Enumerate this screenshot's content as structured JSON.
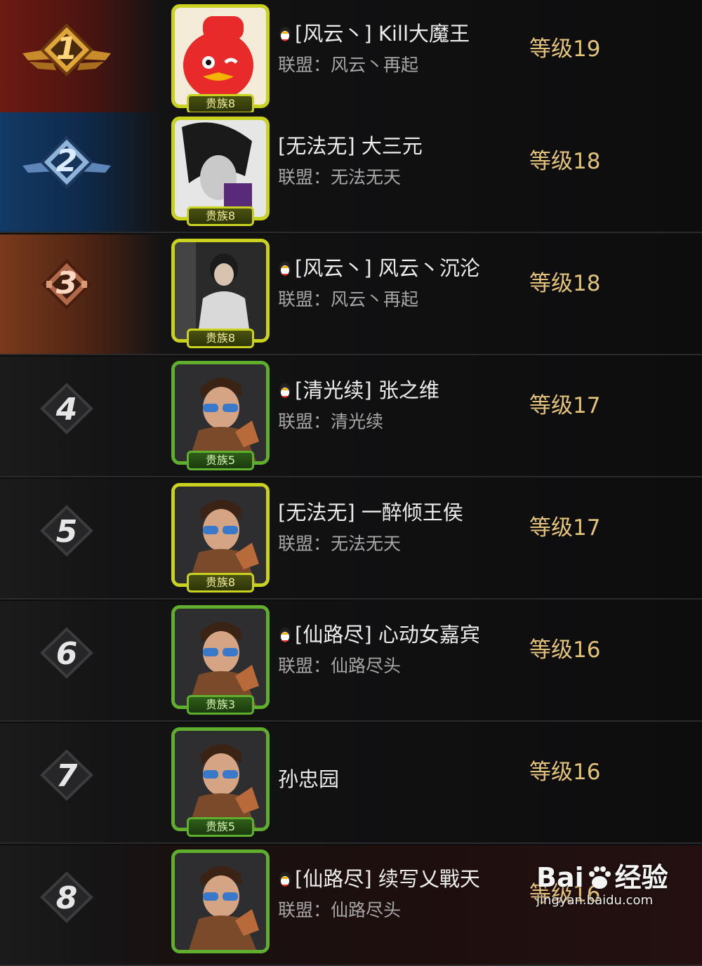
{
  "rows": [
    {
      "rank": "1",
      "name": "[风云丶] Kill大魔王",
      "alliance": "联盟：风云丶再起",
      "level": "等级19",
      "vip": "贵族8",
      "qq_icon": "qq-penguin-icon"
    },
    {
      "rank": "2",
      "name": "[无法无] 大三元",
      "alliance": "联盟：无法无天",
      "level": "等级18",
      "vip": "贵族8",
      "qq_icon": ""
    },
    {
      "rank": "3",
      "name": "[风云丶] 风云丶沉沦",
      "alliance": "联盟：风云丶再起",
      "level": "等级18",
      "vip": "贵族8",
      "qq_icon": "qq-penguin-icon"
    },
    {
      "rank": "4",
      "name": "[清光续] 张之维",
      "alliance": "联盟：清光续",
      "level": "等级17",
      "vip": "贵族5",
      "qq_icon": "qq-penguin-icon"
    },
    {
      "rank": "5",
      "name": "[无法无] 一醉倾王侯",
      "alliance": "联盟：无法无天",
      "level": "等级17",
      "vip": "贵族8",
      "qq_icon": ""
    },
    {
      "rank": "6",
      "name": "[仙路尽] 心动女嘉宾",
      "alliance": "联盟：仙路尽头",
      "level": "等级16",
      "vip": "贵族3",
      "qq_icon": "qq-penguin-icon"
    },
    {
      "rank": "7",
      "name": "孙忠园",
      "alliance": "",
      "level": "等级16",
      "vip": "贵族5",
      "qq_icon": ""
    },
    {
      "rank": "8",
      "name": "[仙路尽] 续写乂戰天",
      "alliance": "联盟：仙路尽头",
      "level": "等级16",
      "vip": "",
      "qq_icon": "qq-penguin-icon"
    }
  ],
  "watermark": {
    "logo_left": "Bai",
    "logo_right": "经验",
    "url": "jingyan.baidu.com"
  },
  "colors": {
    "level": "#e3c27a",
    "vip_gold_frame": "#c9d21e",
    "vip_green_frame": "#5fae2d",
    "rank1_bg": "#6d1a12",
    "rank2_bg": "#123a66",
    "rank3_bg": "#7a3a1c"
  }
}
